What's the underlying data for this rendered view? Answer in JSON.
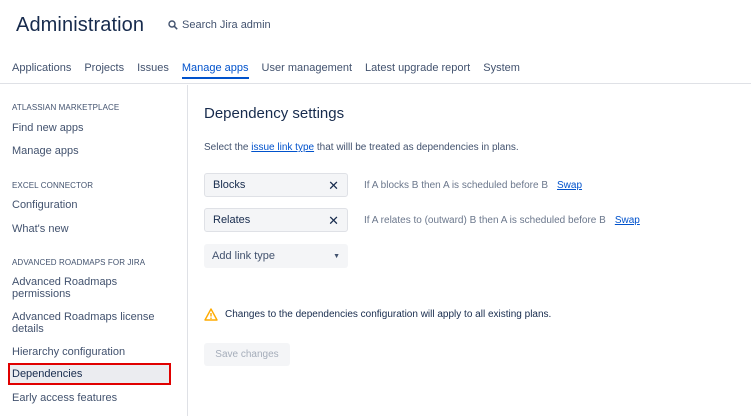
{
  "header": {
    "title": "Administration",
    "search_placeholder": "Search Jira admin"
  },
  "tabs": [
    {
      "label": "Applications",
      "active": false
    },
    {
      "label": "Projects",
      "active": false
    },
    {
      "label": "Issues",
      "active": false
    },
    {
      "label": "Manage apps",
      "active": true
    },
    {
      "label": "User management",
      "active": false
    },
    {
      "label": "Latest upgrade report",
      "active": false
    },
    {
      "label": "System",
      "active": false
    }
  ],
  "sidebar": {
    "sections": [
      {
        "heading": "ATLASSIAN MARKETPLACE",
        "items": [
          "Find new apps",
          "Manage apps"
        ]
      },
      {
        "heading": "EXCEL CONNECTOR",
        "items": [
          "Configuration",
          "What's new"
        ]
      },
      {
        "heading": "ADVANCED ROADMAPS FOR JIRA",
        "items": [
          "Advanced Roadmaps permissions",
          "Advanced Roadmaps license details",
          "Hierarchy configuration",
          "Dependencies",
          "Early access features"
        ]
      }
    ],
    "selected": "Dependencies"
  },
  "main": {
    "title": "Dependency settings",
    "intro_before": "Select the ",
    "intro_link": "issue link type",
    "intro_after": " that willl be treated as dependencies in plans.",
    "link_types": [
      {
        "name": "Blocks",
        "description": "If A blocks B then A is scheduled before B",
        "swap": "Swap"
      },
      {
        "name": "Relates",
        "description": "If A relates to (outward) B then A is scheduled before B",
        "swap": "Swap"
      }
    ],
    "add_link_label": "Add link type",
    "warning": "Changes to the dependencies configuration will apply to all existing plans.",
    "save_label": "Save changes"
  },
  "colors": {
    "accent": "#0052cc",
    "highlight_border": "#e00000",
    "warning": "#ffab00"
  },
  "icons": {
    "search": "search-icon",
    "remove": "close-icon",
    "dropdown": "chevron-down-icon",
    "warning": "warning-icon"
  }
}
